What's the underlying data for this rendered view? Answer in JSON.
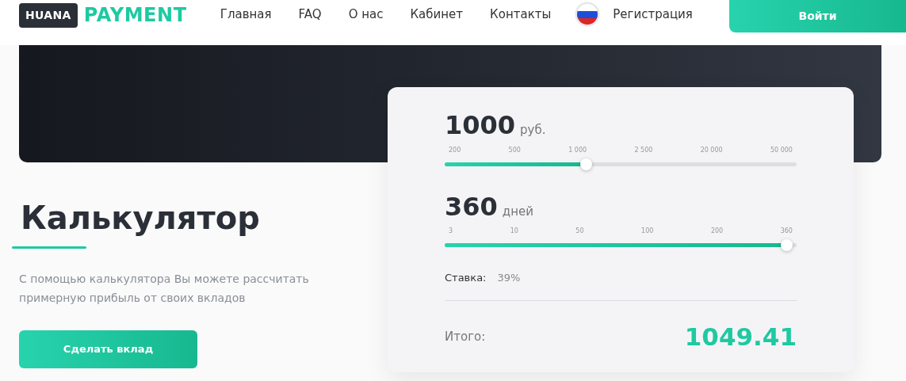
{
  "header": {
    "logo_box": "HUANA",
    "logo_word": "PAYMENT",
    "nav": [
      "Главная",
      "FAQ",
      "О нас",
      "Кабинет",
      "Контакты"
    ],
    "register": "Регистрация",
    "login": "Войти"
  },
  "intro": {
    "title": "Калькулятор",
    "text": "С помощью калькулятора Вы можете рассчитать примерную прибыль от своих вкладов",
    "button": "Сделать вклад"
  },
  "calculator": {
    "sliders": [
      {
        "value": "1000",
        "unit": "руб.",
        "ticks": [
          "200",
          "500",
          "1 000",
          "2 500",
          "20 000",
          "50 000"
        ],
        "level": 0.4
      },
      {
        "value": "360",
        "unit": "дней",
        "ticks": [
          "3",
          "10",
          "50",
          "100",
          "200",
          "360"
        ],
        "level": 0.97
      }
    ],
    "rate_label": "Ставка:",
    "rate": "39%",
    "total_label": "Итого:",
    "total": "1049.41"
  }
}
